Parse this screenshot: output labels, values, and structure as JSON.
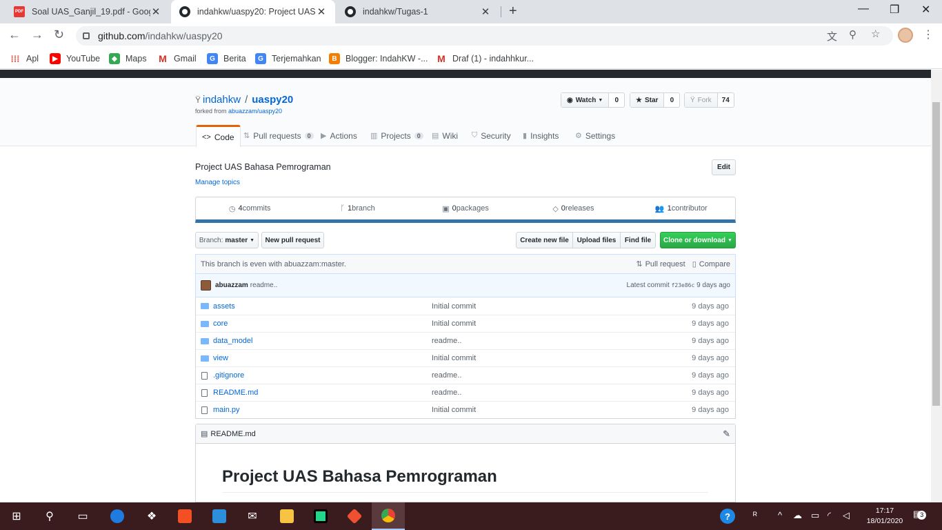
{
  "browser": {
    "tabs": [
      {
        "title": "Soal UAS_Ganjil_19.pdf - Google",
        "favicon": "pdf-icon",
        "active": false
      },
      {
        "title": "indahkw/uaspy20: Project UAS Ba",
        "favicon": "github-icon",
        "active": true
      },
      {
        "title": "indahkw/Tugas-1",
        "favicon": "github-icon",
        "active": false
      }
    ],
    "url_host": "github.com",
    "url_path": "/indahkw/uaspy20",
    "bookmarks": [
      {
        "label": "Apl",
        "icon": "apps-grid-icon"
      },
      {
        "label": "YouTube",
        "icon": "youtube-icon"
      },
      {
        "label": "Maps",
        "icon": "maps-icon"
      },
      {
        "label": "Gmail",
        "icon": "gmail-icon"
      },
      {
        "label": "Berita",
        "icon": "news-icon"
      },
      {
        "label": "Terjemahkan",
        "icon": "translate-icon"
      },
      {
        "label": "Blogger: IndahKW -...",
        "icon": "blogger-icon"
      },
      {
        "label": "Draf (1) - indahhkur...",
        "icon": "gmail-icon"
      }
    ]
  },
  "repo": {
    "owner": "indahkw",
    "name": "uaspy20",
    "forked_prefix": "forked from ",
    "forked_from": "abuazzam/uaspy20",
    "watch_label": "Watch",
    "watch_count": "0",
    "star_label": "Star",
    "star_count": "0",
    "fork_label": "Fork",
    "fork_count": "74"
  },
  "nav": [
    {
      "label": "Code",
      "icon": "code-icon",
      "count": null,
      "selected": true
    },
    {
      "label": "Pull requests",
      "icon": "pull-request-icon",
      "count": "0"
    },
    {
      "label": "Actions",
      "icon": "play-icon",
      "count": null
    },
    {
      "label": "Projects",
      "icon": "project-icon",
      "count": "0"
    },
    {
      "label": "Wiki",
      "icon": "book-icon",
      "count": null
    },
    {
      "label": "Security",
      "icon": "shield-icon",
      "count": null
    },
    {
      "label": "Insights",
      "icon": "graph-icon",
      "count": null
    },
    {
      "label": "Settings",
      "icon": "gear-icon",
      "count": null
    }
  ],
  "description": "Project UAS Bahasa Pemrograman",
  "manage_topics": "Manage topics",
  "edit_label": "Edit",
  "summary": [
    {
      "num": "4",
      "text": " commits",
      "icon": "history-icon"
    },
    {
      "num": "1",
      "text": " branch",
      "icon": "branch-icon"
    },
    {
      "num": "0",
      "text": " packages",
      "icon": "package-icon"
    },
    {
      "num": "0",
      "text": " releases",
      "icon": "tag-icon"
    },
    {
      "num": "1",
      "text": " contributor",
      "icon": "people-icon"
    }
  ],
  "actions": {
    "branch_prefix": "Branch:",
    "branch": "master",
    "new_pr": "New pull request",
    "create_file": "Create new file",
    "upload": "Upload files",
    "find": "Find file",
    "clone": "Clone or download"
  },
  "status": {
    "text": "This branch is even with abuazzam:master.",
    "pull_request": "Pull request",
    "compare": "Compare"
  },
  "commit": {
    "author": "abuazzam",
    "message": "readme..",
    "latest_prefix": "Latest commit ",
    "sha": "f23e86c",
    "age": "9 days ago"
  },
  "files": [
    {
      "name": "assets",
      "type": "dir",
      "message": "Initial commit",
      "age": "9 days ago"
    },
    {
      "name": "core",
      "type": "dir",
      "message": "Initial commit",
      "age": "9 days ago"
    },
    {
      "name": "data_model",
      "type": "dir",
      "message": "readme..",
      "age": "9 days ago"
    },
    {
      "name": "view",
      "type": "dir",
      "message": "Initial commit",
      "age": "9 days ago"
    },
    {
      "name": ".gitignore",
      "type": "file",
      "message": "readme..",
      "age": "9 days ago"
    },
    {
      "name": "README.md",
      "type": "file",
      "message": "readme..",
      "age": "9 days ago"
    },
    {
      "name": "main.py",
      "type": "file",
      "message": "Initial commit",
      "age": "9 days ago"
    }
  ],
  "readme": {
    "filename": "README.md",
    "heading": "Project UAS Bahasa Pemrograman"
  },
  "taskbar": {
    "time": "17:17",
    "date": "18/01/2020",
    "notifications": "3"
  },
  "colors": {
    "accent_orange": "#e36209",
    "link_blue": "#0366d6",
    "clone_green": "#28a745",
    "language_bar": "#3572a5",
    "taskbar": "#3a1c1f"
  }
}
